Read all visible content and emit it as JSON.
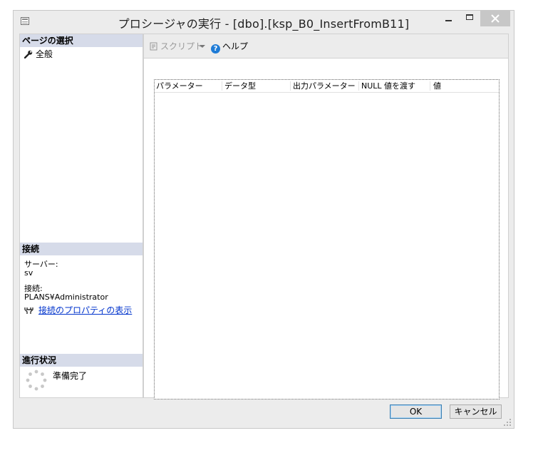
{
  "window": {
    "title": "プロシージャの実行 - [dbo].[ksp_B0_InsertFromB11]"
  },
  "left": {
    "page_select_header": "ページの選択",
    "nav_general": "全般",
    "connection_header": "接続",
    "server_label": "サーバー:",
    "server_value": "sv",
    "connection_label": "接続:",
    "connection_value": "PLANS¥Administrator",
    "connection_properties_link": "接続のプロパティの表示",
    "progress_header": "進行状況",
    "progress_status": "準備完了"
  },
  "toolbar": {
    "script_label": "スクリプト",
    "help_label": "ヘルプ"
  },
  "grid": {
    "columns": [
      "パラメーター",
      "データ型",
      "出力パラメーター",
      "NULL 値を渡す",
      "値"
    ]
  },
  "buttons": {
    "ok": "OK",
    "cancel": "キャンセル"
  },
  "colors": {
    "section_header_bg": "#d6dbe9",
    "link": "#0033cc",
    "help_icon": "#1e7bd6",
    "close_button": "#c7c7c7"
  },
  "icons": [
    "window-app-icon",
    "wrench-icon",
    "plug-icon",
    "spinner-icon",
    "script-icon",
    "dropdown-arrow-icon",
    "help-icon",
    "close-icon",
    "resize-grip-icon"
  ]
}
